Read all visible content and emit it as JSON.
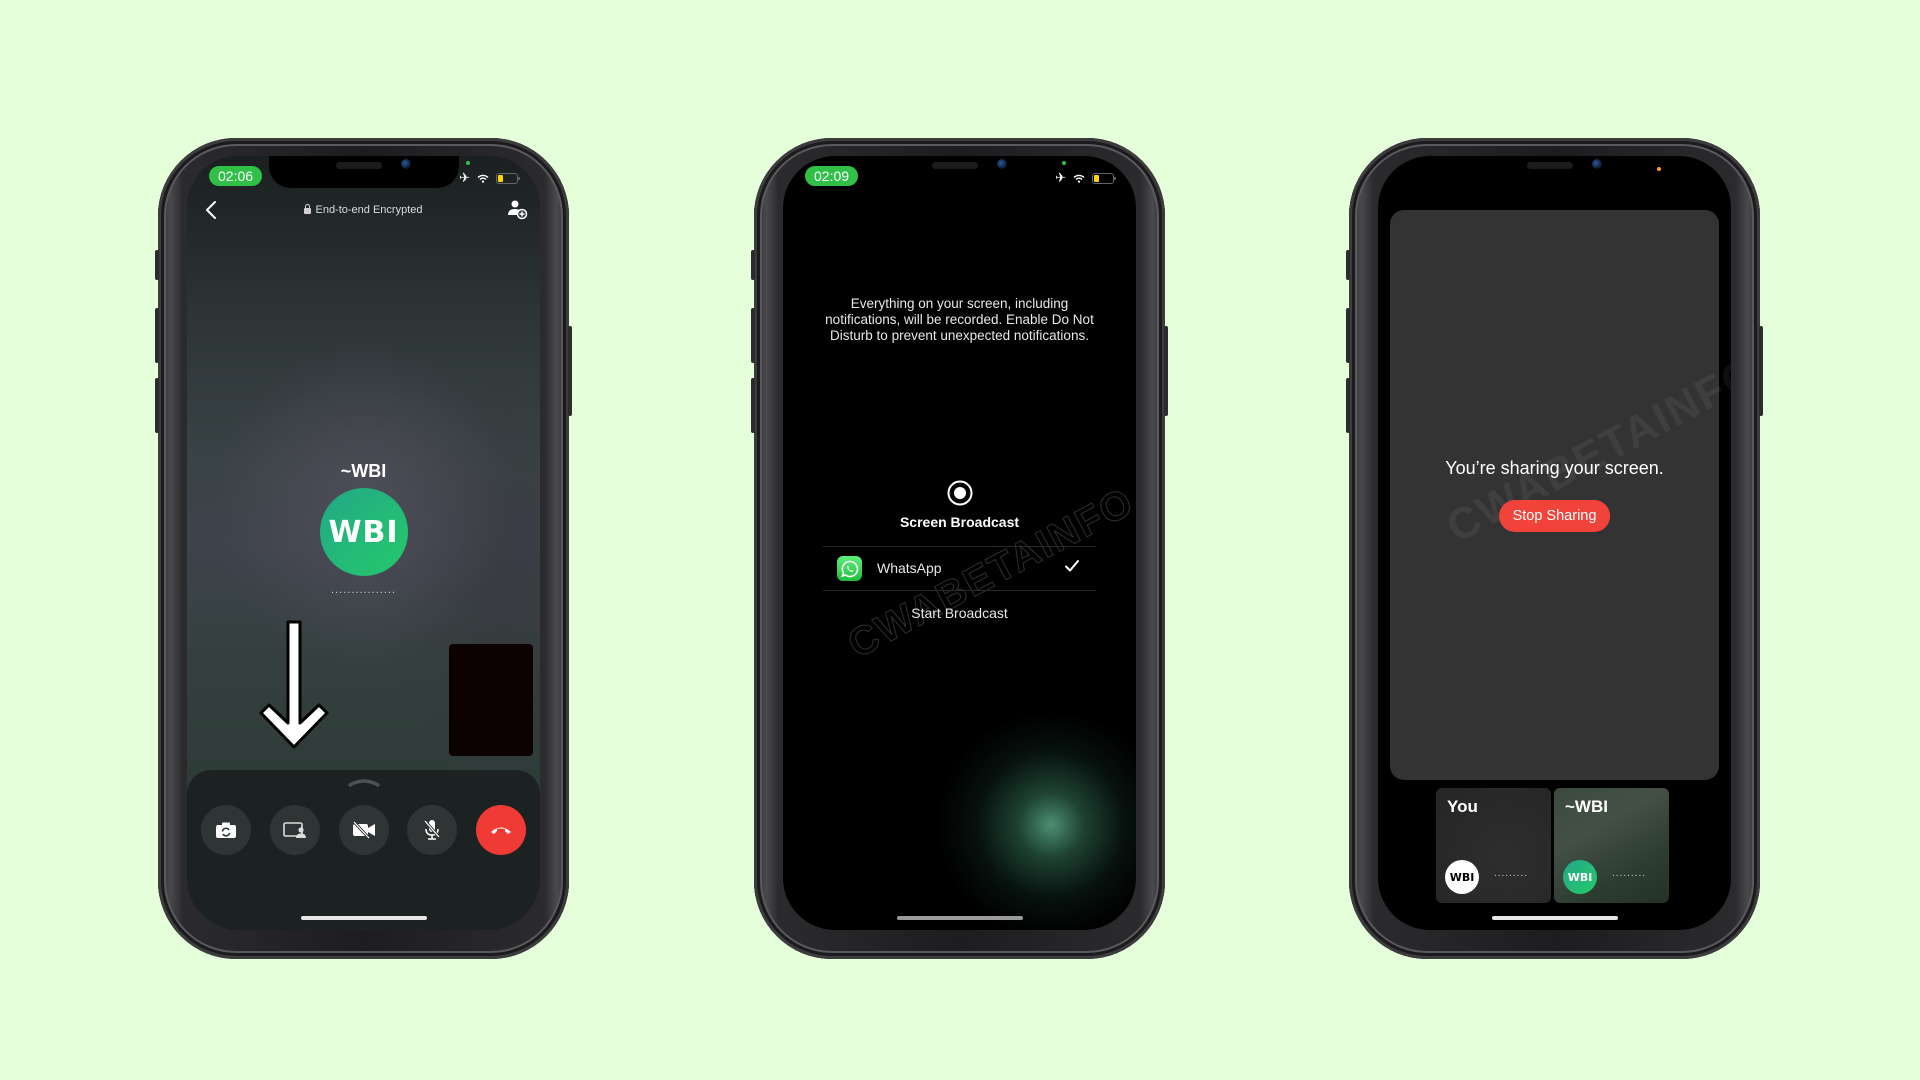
{
  "background_color": "#E5FFDB",
  "phones": [
    {
      "id": "call-screen",
      "status_bar": {
        "time": "02:06",
        "airplane_mode": true,
        "wifi": true,
        "battery_color": "#FFD60A",
        "privacy_indicator": "green"
      },
      "nav": {
        "back_label": "back",
        "encryption_label": "End-to-end Encrypted"
      },
      "contact": {
        "name": "~WBI",
        "avatar_text": "WBI",
        "status": "................"
      },
      "controls": [
        {
          "name": "flip-camera",
          "icon": "camera-flip-icon"
        },
        {
          "name": "share-screen",
          "icon": "screen-share-icon"
        },
        {
          "name": "video-off",
          "icon": "video-off-icon"
        },
        {
          "name": "mute",
          "icon": "mic-off-icon"
        },
        {
          "name": "end-call",
          "icon": "end-call-icon"
        }
      ],
      "annotation": "down-arrow",
      "colors": {
        "end_call": "#F03A35",
        "avatar": "#25C96A"
      }
    },
    {
      "id": "screen-broadcast-picker",
      "status_bar": {
        "time": "02:09",
        "airplane_mode": true,
        "wifi": true,
        "battery_color": "#FFD60A",
        "privacy_indicator": "green"
      },
      "message": "Everything on your screen, including notifications, will be recorded. Enable Do Not Disturb to prevent unexpected notifications.",
      "title": "Screen Broadcast",
      "apps": [
        {
          "name": "WhatsApp",
          "selected": true
        }
      ],
      "start_label": "Start Broadcast",
      "watermark": "CWABETAINFO"
    },
    {
      "id": "sharing-screen",
      "status_bar": {
        "privacy_indicator": "orange"
      },
      "sharing_text": "You’re sharing your screen.",
      "stop_label": "Stop Sharing",
      "participants": [
        {
          "name": "You",
          "avatar_text": "WBI",
          "status": "........."
        },
        {
          "name": "~WBI",
          "avatar_text": "WBI",
          "status": "........."
        }
      ],
      "watermark": "CWABETAINFO",
      "colors": {
        "stop_button": "#F2433A",
        "panel": "#333333"
      }
    }
  ]
}
